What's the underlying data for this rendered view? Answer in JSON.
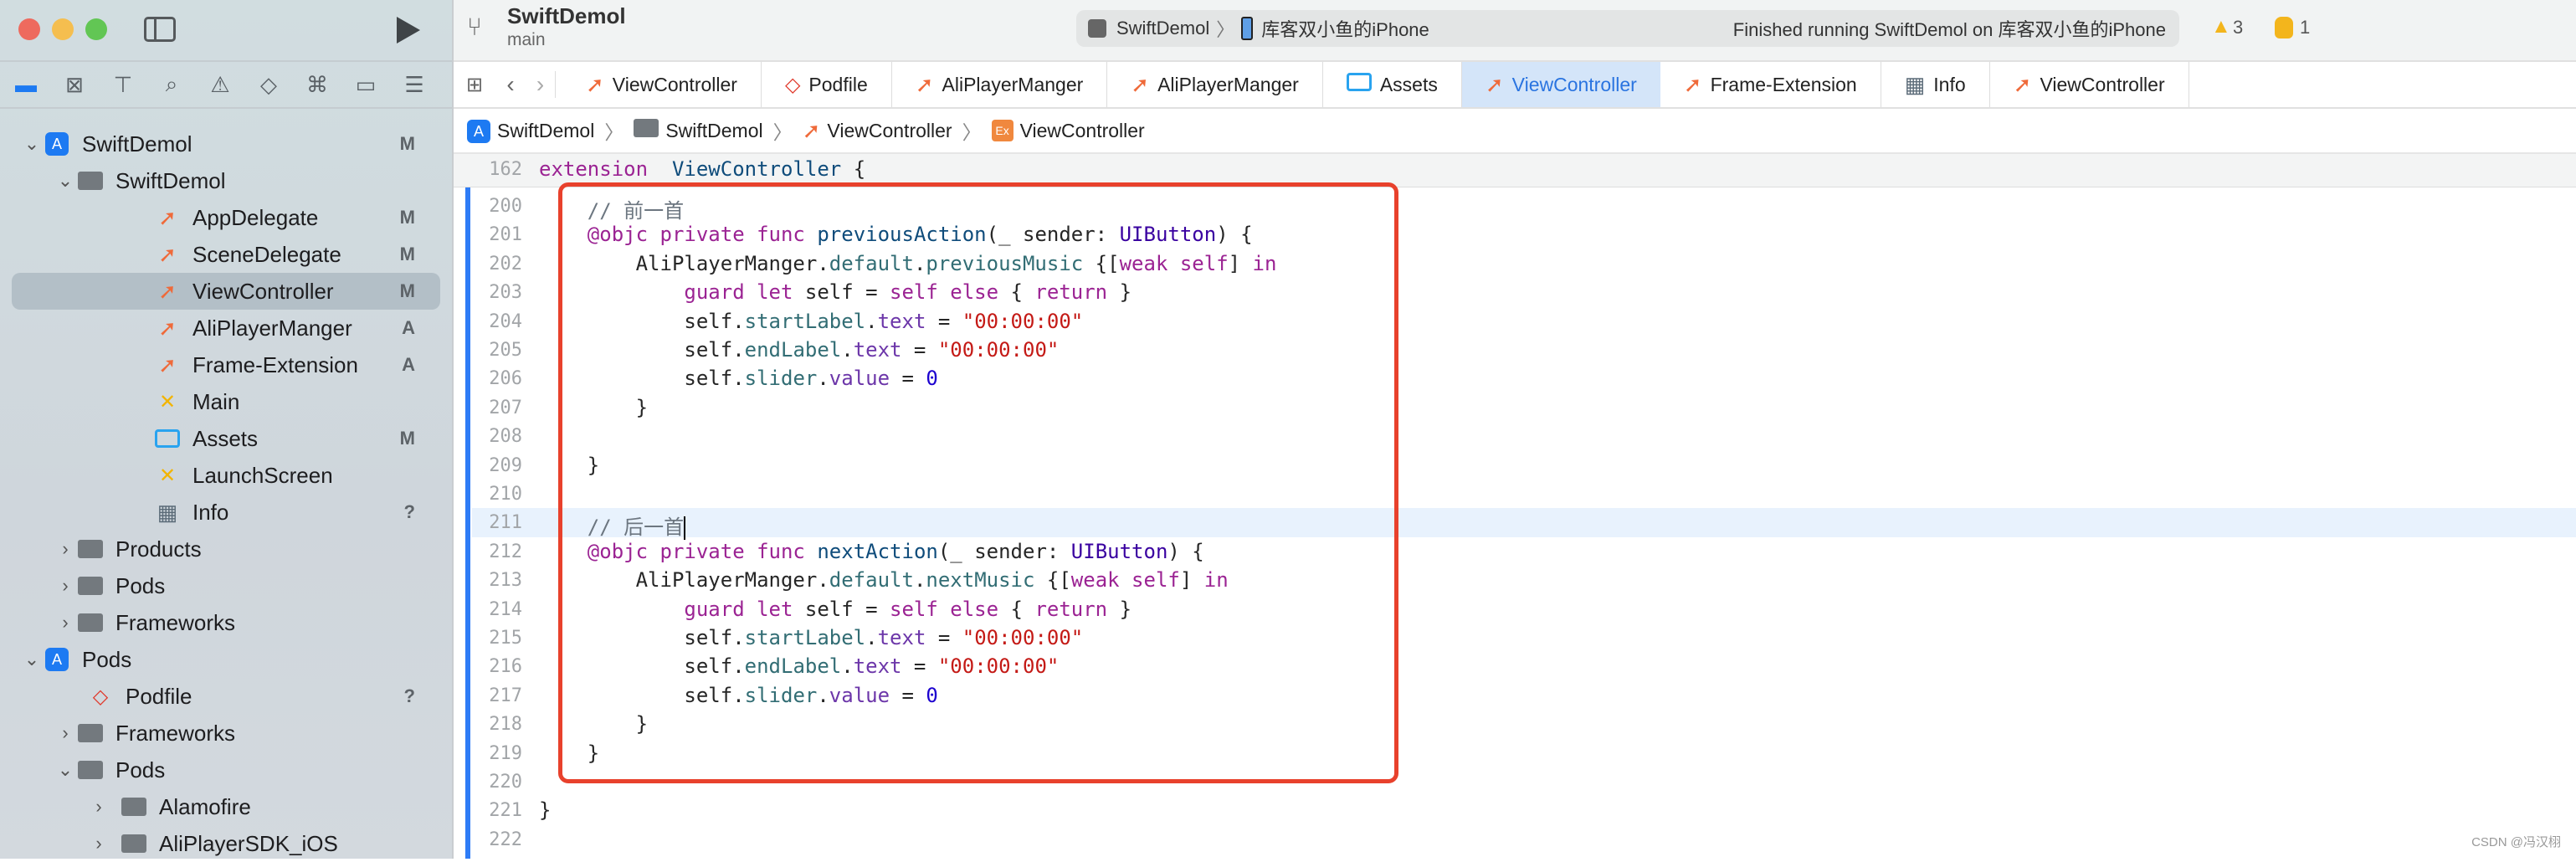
{
  "window": {
    "project": "SwiftDemol",
    "branch": "main",
    "scheme": "SwiftDemol",
    "device": "库客双小鱼的iPhone",
    "status": "Finished running SwiftDemol on 库客双小鱼的iPhone",
    "warnings": "3",
    "errors": "1"
  },
  "navigator_icons": [
    "folder-icon",
    "source-control-icon",
    "hierarchy-icon",
    "search-icon",
    "warning-icon",
    "test-icon",
    "debug-icon",
    "breakpoint-icon",
    "report-icon"
  ],
  "tree": [
    {
      "label": "SwiftDemol",
      "level": 0,
      "icon": "app",
      "chev": "v",
      "badge": "M"
    },
    {
      "label": "SwiftDemol",
      "level": 1,
      "icon": "folder",
      "chev": "v",
      "badge": ""
    },
    {
      "label": "AppDelegate",
      "level": 2,
      "icon": "swift",
      "chev": "",
      "badge": "M"
    },
    {
      "label": "SceneDelegate",
      "level": 2,
      "icon": "swift",
      "chev": "",
      "badge": "M"
    },
    {
      "label": "ViewController",
      "level": 2,
      "icon": "swift",
      "chev": "",
      "badge": "M",
      "selected": true
    },
    {
      "label": "AliPlayerManger",
      "level": 2,
      "icon": "swift",
      "chev": "",
      "badge": "A"
    },
    {
      "label": "Frame-Extension",
      "level": 2,
      "icon": "swift",
      "chev": "",
      "badge": "A"
    },
    {
      "label": "Main",
      "level": 2,
      "icon": "storyboard",
      "chev": "",
      "badge": ""
    },
    {
      "label": "Assets",
      "level": 2,
      "icon": "assets",
      "chev": "",
      "badge": "M"
    },
    {
      "label": "LaunchScreen",
      "level": 2,
      "icon": "storyboard",
      "chev": "",
      "badge": ""
    },
    {
      "label": "Info",
      "level": 2,
      "icon": "plist",
      "chev": "",
      "badge": "?"
    },
    {
      "label": "Products",
      "level": 1,
      "icon": "folder",
      "chev": ">",
      "badge": ""
    },
    {
      "label": "Pods",
      "level": 1,
      "icon": "folder",
      "chev": ">",
      "badge": ""
    },
    {
      "label": "Frameworks",
      "level": 1,
      "icon": "folder",
      "chev": ">",
      "badge": ""
    },
    {
      "label": "Pods",
      "level": 0,
      "icon": "app",
      "chev": "v",
      "badge": ""
    },
    {
      "label": "Podfile",
      "level": 1,
      "icon": "ruby",
      "chev": "",
      "badge": "?"
    },
    {
      "label": "Frameworks",
      "level": 1,
      "icon": "folder",
      "chev": ">",
      "badge": ""
    },
    {
      "label": "Pods",
      "level": 1,
      "icon": "folder",
      "chev": "v",
      "badge": ""
    },
    {
      "label": "Alamofire",
      "level": 2,
      "icon": "folder",
      "chev": ">",
      "badge": ""
    },
    {
      "label": "AliPlayerSDK_iOS",
      "level": 2,
      "icon": "folder",
      "chev": ">",
      "badge": ""
    }
  ],
  "tabs": [
    {
      "label": "ViewController",
      "icon": "swift"
    },
    {
      "label": "Podfile",
      "icon": "ruby"
    },
    {
      "label": "AliPlayerManger",
      "icon": "swift"
    },
    {
      "label": "AliPlayerManger",
      "icon": "swift"
    },
    {
      "label": "Assets",
      "icon": "assets"
    },
    {
      "label": "ViewController",
      "icon": "swift",
      "active": true
    },
    {
      "label": "Frame-Extension",
      "icon": "swift"
    },
    {
      "label": "Info",
      "icon": "plist"
    },
    {
      "label": "ViewController",
      "icon": "swift"
    }
  ],
  "breadcrumb": [
    "SwiftDemol",
    "SwiftDemol",
    "ViewController",
    "ViewController"
  ],
  "sticky": {
    "num": "162",
    "tokens": [
      [
        "kw",
        "extension"
      ],
      [
        "",
        "",
        " "
      ],
      [
        "fn",
        " ViewController"
      ],
      [
        "",
        " {"
      ]
    ]
  },
  "current_line": "211",
  "lines": [
    {
      "num": "200",
      "tokens": [
        [
          "",
          "    "
        ],
        [
          "cm",
          "// 前一首"
        ]
      ]
    },
    {
      "num": "201",
      "tokens": [
        [
          "",
          "    "
        ],
        [
          "kw",
          "@objc private func "
        ],
        [
          "fn",
          "previousAction"
        ],
        [
          "",
          "(_ sender: "
        ],
        [
          "ty",
          "UIButton"
        ],
        [
          "",
          ") {"
        ]
      ]
    },
    {
      "num": "202",
      "tokens": [
        [
          "",
          "        AliPlayerManger."
        ],
        [
          "pr",
          "default"
        ],
        [
          "",
          "."
        ],
        [
          "pr",
          "previousMusic"
        ],
        [
          "",
          " {["
        ],
        [
          "kw",
          "weak self"
        ],
        [
          "",
          "] "
        ],
        [
          "kw",
          "in"
        ]
      ]
    },
    {
      "num": "203",
      "tokens": [
        [
          "",
          "            "
        ],
        [
          "kw",
          "guard let"
        ],
        [
          "",
          " self = "
        ],
        [
          "kw",
          "self else"
        ],
        [
          "",
          " { "
        ],
        [
          "kw",
          "return"
        ],
        [
          "",
          " }"
        ]
      ]
    },
    {
      "num": "204",
      "tokens": [
        [
          "",
          "            self."
        ],
        [
          "pr",
          "startLabel"
        ],
        [
          "",
          "."
        ],
        [
          "pp",
          "text"
        ],
        [
          "",
          " = "
        ],
        [
          "st",
          "\"00:00:00\""
        ]
      ]
    },
    {
      "num": "205",
      "tokens": [
        [
          "",
          "            self."
        ],
        [
          "pr",
          "endLabel"
        ],
        [
          "",
          "."
        ],
        [
          "pp",
          "text"
        ],
        [
          "",
          " = "
        ],
        [
          "st",
          "\"00:00:00\""
        ]
      ]
    },
    {
      "num": "206",
      "tokens": [
        [
          "",
          "            self."
        ],
        [
          "pr",
          "slider"
        ],
        [
          "",
          "."
        ],
        [
          "pp",
          "value"
        ],
        [
          "",
          " = "
        ],
        [
          "nu",
          "0"
        ]
      ]
    },
    {
      "num": "207",
      "tokens": [
        [
          "",
          "        }"
        ]
      ]
    },
    {
      "num": "208",
      "tokens": []
    },
    {
      "num": "209",
      "tokens": [
        [
          "",
          "    }"
        ]
      ]
    },
    {
      "num": "210",
      "tokens": []
    },
    {
      "num": "211",
      "tokens": [
        [
          "",
          "    "
        ],
        [
          "cm",
          "// 后一首"
        ]
      ]
    },
    {
      "num": "212",
      "tokens": [
        [
          "",
          "    "
        ],
        [
          "kw",
          "@objc private func "
        ],
        [
          "fn",
          "nextAction"
        ],
        [
          "",
          "(_ sender: "
        ],
        [
          "ty",
          "UIButton"
        ],
        [
          "",
          ") {"
        ]
      ]
    },
    {
      "num": "213",
      "tokens": [
        [
          "",
          "        AliPlayerManger."
        ],
        [
          "pr",
          "default"
        ],
        [
          "",
          "."
        ],
        [
          "pr",
          "nextMusic"
        ],
        [
          "",
          " {["
        ],
        [
          "kw",
          "weak self"
        ],
        [
          "",
          "] "
        ],
        [
          "kw",
          "in"
        ]
      ]
    },
    {
      "num": "214",
      "tokens": [
        [
          "",
          "            "
        ],
        [
          "kw",
          "guard let"
        ],
        [
          "",
          " self = "
        ],
        [
          "kw",
          "self else"
        ],
        [
          "",
          " { "
        ],
        [
          "kw",
          "return"
        ],
        [
          "",
          " }"
        ]
      ]
    },
    {
      "num": "215",
      "tokens": [
        [
          "",
          "            self."
        ],
        [
          "pr",
          "startLabel"
        ],
        [
          "",
          "."
        ],
        [
          "pp",
          "text"
        ],
        [
          "",
          " = "
        ],
        [
          "st",
          "\"00:00:00\""
        ]
      ]
    },
    {
      "num": "216",
      "tokens": [
        [
          "",
          "            self."
        ],
        [
          "pr",
          "endLabel"
        ],
        [
          "",
          "."
        ],
        [
          "pp",
          "text"
        ],
        [
          "",
          " = "
        ],
        [
          "st",
          "\"00:00:00\""
        ]
      ]
    },
    {
      "num": "217",
      "tokens": [
        [
          "",
          "            self."
        ],
        [
          "pr",
          "slider"
        ],
        [
          "",
          "."
        ],
        [
          "pp",
          "value"
        ],
        [
          "",
          " = "
        ],
        [
          "nu",
          "0"
        ]
      ]
    },
    {
      "num": "218",
      "tokens": [
        [
          "",
          "        }"
        ]
      ]
    },
    {
      "num": "219",
      "tokens": [
        [
          "",
          "    }"
        ]
      ]
    },
    {
      "num": "220",
      "tokens": []
    },
    {
      "num": "221",
      "tokens": [
        [
          "",
          "}"
        ]
      ]
    },
    {
      "num": "222",
      "tokens": []
    }
  ],
  "annotation_color": "#e8412c",
  "watermark": "CSDN @冯汉栩"
}
